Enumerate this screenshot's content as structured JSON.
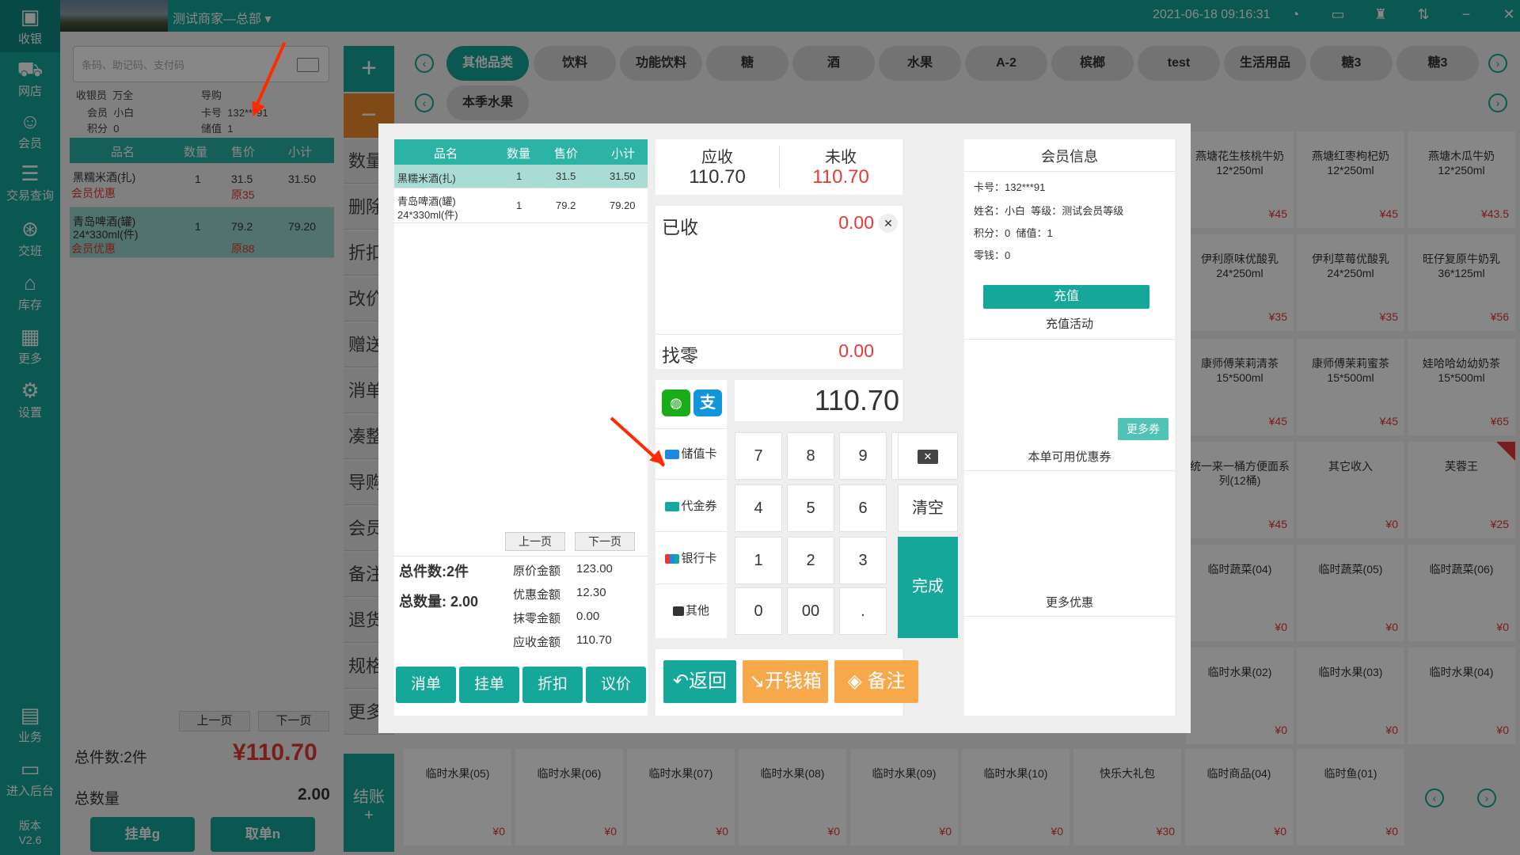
{
  "nav": {
    "items": [
      {
        "label": "收银",
        "icon": "cashier-icon"
      },
      {
        "label": "网店",
        "icon": "scooter-icon"
      },
      {
        "label": "会员",
        "icon": "user-icon"
      },
      {
        "label": "交易查询",
        "icon": "document-icon"
      },
      {
        "label": "交班",
        "icon": "shift-icon"
      },
      {
        "label": "库存",
        "icon": "warehouse-icon"
      },
      {
        "label": "更多",
        "icon": "grid-icon"
      },
      {
        "label": "设置",
        "icon": "gear-icon"
      },
      {
        "label": "业务",
        "icon": "business-icon"
      },
      {
        "label": "进入后台",
        "icon": "monitor-icon"
      }
    ],
    "version_label": "版本",
    "version": "V2.6"
  },
  "topbar": {
    "merchant": "测试商家—总部",
    "datetime": "2021-06-18 09:16:31"
  },
  "order": {
    "search_placeholder": "条码、助记码、支付码",
    "cashier_label": "收银员",
    "cashier": "万全",
    "guide_label": "导购",
    "member_label": "会员",
    "member": "小白",
    "card_label": "卡号",
    "card": "132***91",
    "points_label": "积分",
    "points": "0",
    "balance_label": "储值",
    "balance": "1",
    "columns": [
      "品名",
      "数量",
      "售价",
      "小计"
    ],
    "rows": [
      {
        "name": "黑糯米酒(扎)",
        "qty": "1",
        "price": "31.5",
        "subtotal": "31.50",
        "tag": "会员优惠",
        "orig": "原35"
      },
      {
        "name": "青岛啤酒(罐)",
        "name2": "24*330ml(件)",
        "qty": "1",
        "price": "79.2",
        "subtotal": "79.20",
        "tag": "会员优惠",
        "orig": "原88"
      }
    ],
    "prev": "上一页",
    "next": "下一页",
    "total_items": "总件数:2件",
    "total_amount": "¥110.70",
    "total_qty_label": "总数量",
    "total_qty": "2.00",
    "hang_btn": "挂单g",
    "take_btn": "取单n"
  },
  "mid": {
    "plus": "+",
    "minus": "−",
    "buttons": [
      "数量",
      "删除",
      "折扣",
      "改价",
      "赠送",
      "消单",
      "凑整",
      "导购",
      "会员",
      "备注",
      "退货",
      "规格",
      "更多"
    ],
    "checkout": "结账",
    "checkout_plus": "+"
  },
  "categories": {
    "row1": [
      "其他品类",
      "饮料",
      "功能饮料",
      "糖",
      "酒",
      "水果",
      "A-2",
      "槟榔",
      "test",
      "生活用品",
      "糖3",
      "糖3"
    ],
    "row2": [
      "本季水果"
    ]
  },
  "products": [
    {
      "name": "燕塘花生核桃牛奶12*250ml",
      "price": "¥45"
    },
    {
      "name": "燕塘红枣枸杞奶12*250ml",
      "price": "¥45"
    },
    {
      "name": "燕塘木瓜牛奶12*250ml",
      "price": "¥43.5"
    },
    {
      "name": "伊利原味优酸乳24*250ml",
      "price": "¥35"
    },
    {
      "name": "伊利草莓优酸乳24*250ml",
      "price": "¥35"
    },
    {
      "name": "旺仔复原牛奶乳36*125ml",
      "price": "¥56"
    },
    {
      "name": "康师傅茉莉清茶15*500ml",
      "price": "¥45"
    },
    {
      "name": "康师傅茉莉蜜茶15*500ml",
      "price": "¥45"
    },
    {
      "name": "娃哈哈幼幼奶茶15*500ml",
      "price": "¥65"
    },
    {
      "name": "统一来一桶方便面系列(12桶)",
      "price": "¥45"
    },
    {
      "name": "其它收入",
      "price": "¥0"
    },
    {
      "name": "芙蓉王",
      "price": "¥25"
    },
    {
      "name": "临时蔬菜(04)",
      "price": "¥0"
    },
    {
      "name": "临时蔬菜(05)",
      "price": "¥0"
    },
    {
      "name": "临时蔬菜(06)",
      "price": "¥0"
    },
    {
      "name": "临时水果(02)",
      "price": "¥0"
    },
    {
      "name": "临时水果(03)",
      "price": "¥0"
    },
    {
      "name": "临时水果(04)",
      "price": "¥0"
    }
  ],
  "products_bottom": [
    {
      "name": "临时水果(05)",
      "price": "¥0"
    },
    {
      "name": "临时水果(06)",
      "price": "¥0"
    },
    {
      "name": "临时水果(07)",
      "price": "¥0"
    },
    {
      "name": "临时水果(08)",
      "price": "¥0"
    },
    {
      "name": "临时水果(09)",
      "price": "¥0"
    },
    {
      "name": "临时水果(10)",
      "price": "¥0"
    },
    {
      "name": "快乐大礼包",
      "price": "¥30"
    },
    {
      "name": "临时商品(04)",
      "price": "¥0"
    },
    {
      "name": "临时鱼(01)",
      "price": "¥0"
    }
  ],
  "modal": {
    "columns": [
      "品名",
      "数量",
      "售价",
      "小计"
    ],
    "rows": [
      {
        "name": "黑糯米酒(扎)",
        "qty": "1",
        "price": "31.5",
        "subtotal": "31.50"
      },
      {
        "name": "青岛啤酒(罐)",
        "name2": "24*330ml(件)",
        "qty": "1",
        "price": "79.2",
        "subtotal": "79.20"
      }
    ],
    "prev": "上一页",
    "next": "下一页",
    "total_items_label": "总件数:",
    "total_items": "2件",
    "total_qty_label": "总数量:",
    "total_qty": "2.00",
    "orig_label": "原价金额",
    "orig": "123.00",
    "discount_label": "优惠金额",
    "discount": "12.30",
    "round_label": "抹零金额",
    "round": "0.00",
    "due_label": "应收金额",
    "due": "110.70",
    "buttons": [
      "消单",
      "挂单",
      "折扣",
      "议价"
    ],
    "receivable_label": "应收",
    "receivable": "110.70",
    "unpaid_label": "未收",
    "unpaid": "110.70",
    "received_label": "已收",
    "received": "0.00",
    "change_label": "找零",
    "change": "0.00",
    "pay_methods": [
      "储值卡",
      "代金券",
      "银行卡",
      "其他"
    ],
    "amount": "110.70",
    "keys": [
      "7",
      "8",
      "9",
      "4",
      "5",
      "6",
      "1",
      "2",
      "3",
      "0",
      "00",
      "."
    ],
    "clear": "清空",
    "done": "完成",
    "back": "返回",
    "drawer": "开钱箱",
    "note": "备注",
    "member_title": "会员信息",
    "card_line": "卡号：132***91",
    "name_line": "姓名：小白  等级：测试会员等级",
    "points_line": "积分：0  储值：1",
    "change_line": "零钱：0",
    "recharge": "充值",
    "recharge_activity": "充值活动",
    "more_coupons": "更多券",
    "available_coupons": "本单可用优惠券",
    "more_offers": "更多优惠"
  },
  "colors": {
    "brand": "#16a79b",
    "accent_red": "#e53935",
    "orange": "#f7a84a"
  }
}
